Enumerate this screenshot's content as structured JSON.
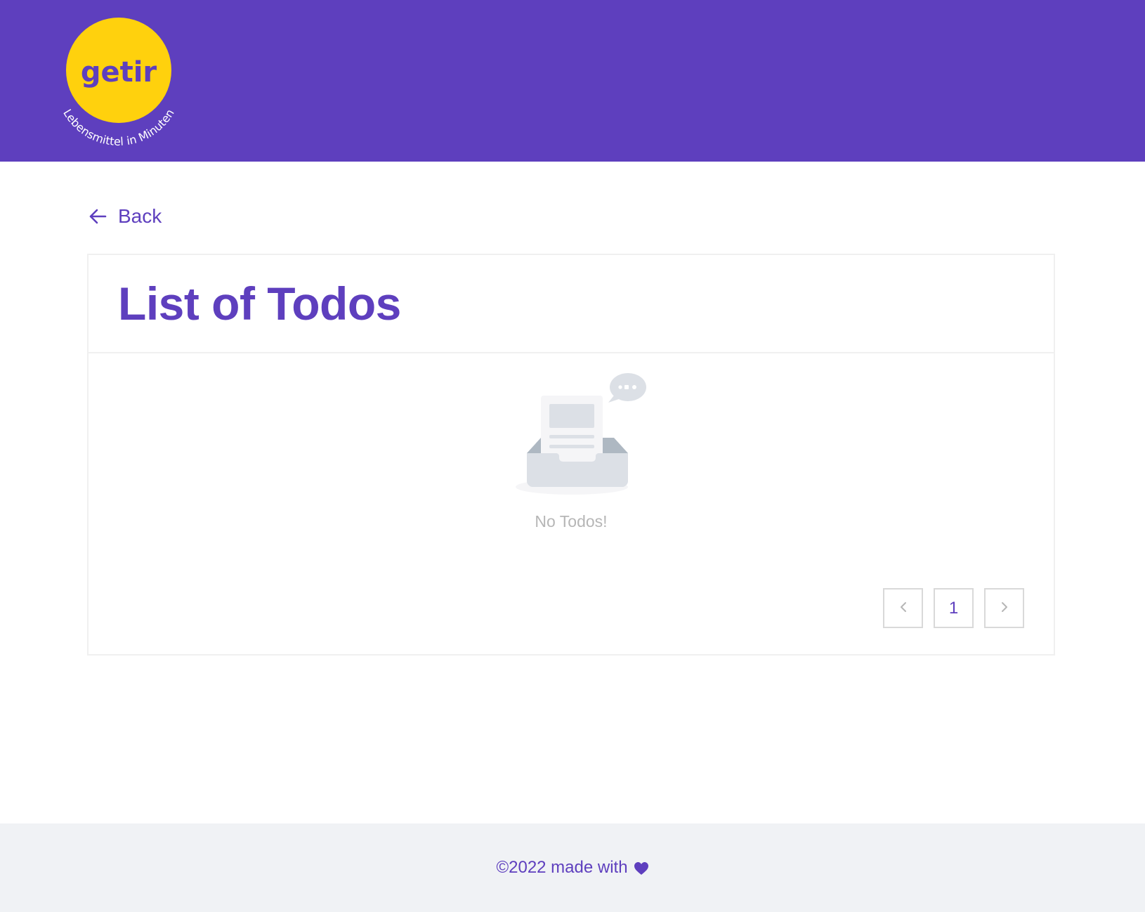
{
  "header": {
    "brand": "getir",
    "tagline": "Lebensmittel in Minuten",
    "logo_icon": "getir-logo-icon",
    "colors": {
      "primary": "#5e3fbe",
      "logo_yellow": "#ffd10d"
    }
  },
  "nav": {
    "back_label": "Back",
    "back_icon": "arrow-left-icon"
  },
  "card": {
    "title": "List of Todos",
    "empty_text": "No Todos!",
    "empty_icon": "empty-inbox-icon"
  },
  "pagination": {
    "prev_icon": "chevron-left-icon",
    "next_icon": "chevron-right-icon",
    "current_page": "1"
  },
  "footer": {
    "text": "©2022 made with",
    "heart_icon": "heart-icon"
  }
}
